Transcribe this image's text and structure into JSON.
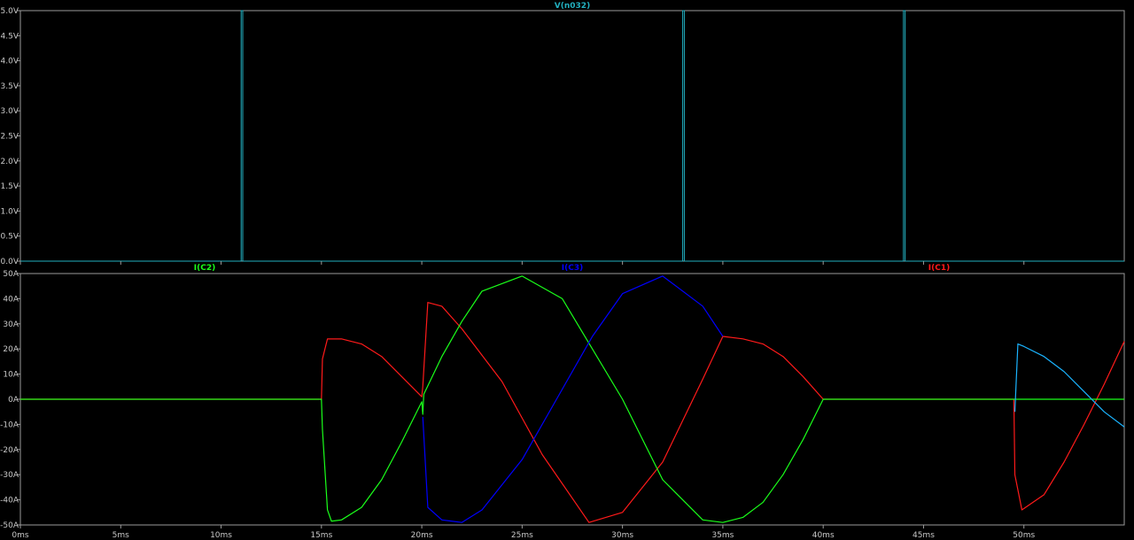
{
  "colors": {
    "background": "#000000",
    "frame": "#9a9a9a",
    "tick_text": "#c8c8c8",
    "vn032": "#22b0c0",
    "ic1": "#ff1a1a",
    "ic2": "#1aff1a",
    "ic3": "#0000ff",
    "light_blue": "#1ab4ff"
  },
  "chart_data": [
    {
      "type": "line",
      "title": "V(n032)",
      "xlim": [
        0,
        55
      ],
      "x_unit": "ms",
      "ylim": [
        0,
        5
      ],
      "y_ticks": [
        "5.0V",
        "4.5V",
        "4.0V",
        "3.5V",
        "3.0V",
        "2.5V",
        "2.0V",
        "1.5V",
        "1.0V",
        "0.5V",
        "0.0V"
      ],
      "series": [
        {
          "name": "V(n032)",
          "color": "#22b0c0",
          "x": [
            0,
            11,
            11,
            11.08,
            11.08,
            33,
            33,
            33.08,
            33.08,
            44,
            44,
            44.08,
            44.08,
            55
          ],
          "y": [
            0,
            0,
            5,
            5,
            0,
            0,
            5,
            5,
            0,
            0,
            5,
            5,
            0,
            0
          ]
        }
      ]
    },
    {
      "type": "line",
      "titles": [
        {
          "text": "I(C2)",
          "color": "#1aff1a"
        },
        {
          "text": "I(C3)",
          "color": "#0000ff"
        },
        {
          "text": "I(C1)",
          "color": "#ff1a1a"
        }
      ],
      "xlim": [
        0,
        55
      ],
      "x_unit": "ms",
      "x_ticks": [
        "0ms",
        "5ms",
        "10ms",
        "15ms",
        "20ms",
        "25ms",
        "30ms",
        "35ms",
        "40ms",
        "45ms",
        "50ms"
      ],
      "ylim": [
        -50,
        50
      ],
      "y_ticks": [
        "50A",
        "40A",
        "30A",
        "20A",
        "10A",
        "0A",
        "-10A",
        "-20A",
        "-30A",
        "-40A",
        "-50A"
      ],
      "series": [
        {
          "name": "I(C1)",
          "color": "#ff1a1a",
          "x": [
            0,
            15,
            15.05,
            15.3,
            16,
            17,
            18,
            19,
            20,
            20.05,
            20.3,
            21,
            22,
            24,
            26,
            28.33,
            30,
            32,
            34,
            35,
            36,
            37,
            38,
            39,
            40,
            49.5,
            49.55,
            49.9,
            51,
            52,
            53,
            54,
            55
          ],
          "y": [
            0,
            0,
            16,
            24,
            24,
            22,
            17,
            9,
            1,
            5,
            38.5,
            37,
            28,
            7,
            -22,
            -49,
            -45,
            -25,
            8,
            25,
            24,
            22,
            17,
            9,
            0,
            0,
            -30,
            -44,
            -38,
            -25,
            -10,
            6,
            23
          ]
        },
        {
          "name": "I(C2)",
          "color": "#1aff1a",
          "x": [
            0,
            15,
            15.05,
            15.3,
            15.5,
            16,
            17,
            18,
            19,
            20,
            20.05,
            20.1,
            20.4,
            21,
            22,
            23,
            25,
            27,
            30,
            32,
            34,
            35,
            36,
            37,
            38,
            39,
            40,
            55
          ],
          "y": [
            0,
            0,
            -12,
            -44,
            -48.5,
            -48,
            -43,
            -32,
            -17,
            -1,
            -6,
            2,
            7,
            17,
            31,
            43,
            49,
            40,
            0,
            -32,
            -48,
            -49,
            -47,
            -41,
            -30,
            -16,
            0,
            0
          ]
        },
        {
          "name": "I(C3)",
          "color": "#0000ff",
          "x": [
            20.05,
            20.3,
            21,
            22,
            23,
            25,
            27,
            28.5,
            30,
            32,
            34,
            35
          ],
          "y": [
            -7,
            -43,
            -48,
            -49,
            -44,
            -24,
            4,
            25,
            42,
            49,
            37,
            25
          ]
        },
        {
          "name": "",
          "color": "#1ab4ff",
          "x": [
            49.55,
            49.7,
            50,
            51,
            52,
            53,
            54,
            55
          ],
          "y": [
            -5,
            22,
            21,
            17,
            11,
            3,
            -5,
            -11
          ]
        }
      ]
    }
  ]
}
